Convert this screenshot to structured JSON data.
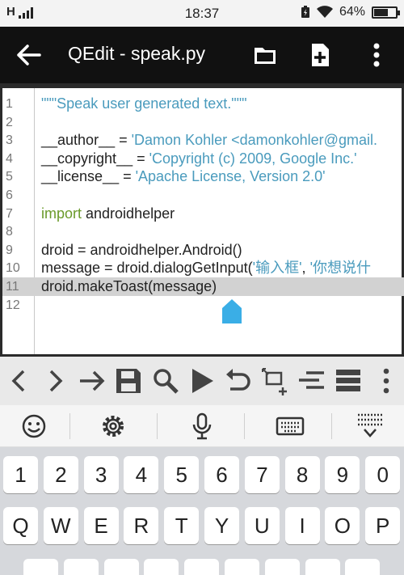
{
  "status_bar": {
    "network": "H",
    "time": "18:37",
    "battery": "64%",
    "battery_level": 0.64
  },
  "app_bar": {
    "title": "QEdit - speak.py",
    "icons": [
      "back-arrow-icon",
      "folder-icon",
      "new-file-icon",
      "more-vert-icon"
    ]
  },
  "editor": {
    "lines": [
      {
        "n": "1",
        "parts": [
          {
            "t": "\"\"\"Speak user generated text.\"\"\"",
            "c": "str"
          }
        ]
      },
      {
        "n": "2",
        "parts": []
      },
      {
        "n": "3",
        "parts": [
          {
            "t": "__author__ = ",
            "c": ""
          },
          {
            "t": "'Damon Kohler <damonkohler@gmail.",
            "c": "str"
          }
        ]
      },
      {
        "n": "4",
        "parts": [
          {
            "t": "__copyright__ = ",
            "c": ""
          },
          {
            "t": "'Copyright (c) 2009, Google Inc.'",
            "c": "str"
          }
        ]
      },
      {
        "n": "5",
        "parts": [
          {
            "t": "__license__ = ",
            "c": ""
          },
          {
            "t": "'Apache License, Version 2.0'",
            "c": "str"
          }
        ]
      },
      {
        "n": "6",
        "parts": []
      },
      {
        "n": "7",
        "parts": [
          {
            "t": "import",
            "c": "kw"
          },
          {
            "t": " androidhelper",
            "c": ""
          }
        ]
      },
      {
        "n": "8",
        "parts": []
      },
      {
        "n": "9",
        "parts": [
          {
            "t": "droid = androidhelper.Android()",
            "c": ""
          }
        ]
      },
      {
        "n": "10",
        "parts": [
          {
            "t": "message = droid.dialogGetInput(",
            "c": ""
          },
          {
            "t": "'输入框'",
            "c": "str"
          },
          {
            "t": ", ",
            "c": ""
          },
          {
            "t": "'你想说什",
            "c": "str"
          }
        ]
      },
      {
        "n": "11",
        "parts": [
          {
            "t": "droid.makeToast(message)",
            "c": ""
          }
        ],
        "highlight": true
      },
      {
        "n": "12",
        "parts": []
      }
    ],
    "colors": {
      "string": "#4a9bbd",
      "keyword": "#6a9a2a",
      "highlight": "#d2d2d2",
      "cursor": "#3aaee6"
    }
  },
  "toolbar": {
    "icons": [
      "chevron-left-icon",
      "chevron-right-icon",
      "goto-arrow-icon",
      "save-icon",
      "search-icon",
      "run-icon",
      "undo-icon",
      "add-snippet-icon",
      "indent-icon",
      "list-icon",
      "more-vert-icon"
    ]
  },
  "keyboard": {
    "top_icons": [
      "emoji-icon",
      "settings-icon",
      "microphone-icon",
      "keyboard-icon",
      "keyboard-hide-icon"
    ],
    "number_row": [
      "1",
      "2",
      "3",
      "4",
      "5",
      "6",
      "7",
      "8",
      "9",
      "0"
    ],
    "letter_row": [
      "Q",
      "W",
      "E",
      "R",
      "T",
      "Y",
      "U",
      "I",
      "O",
      "P"
    ]
  }
}
